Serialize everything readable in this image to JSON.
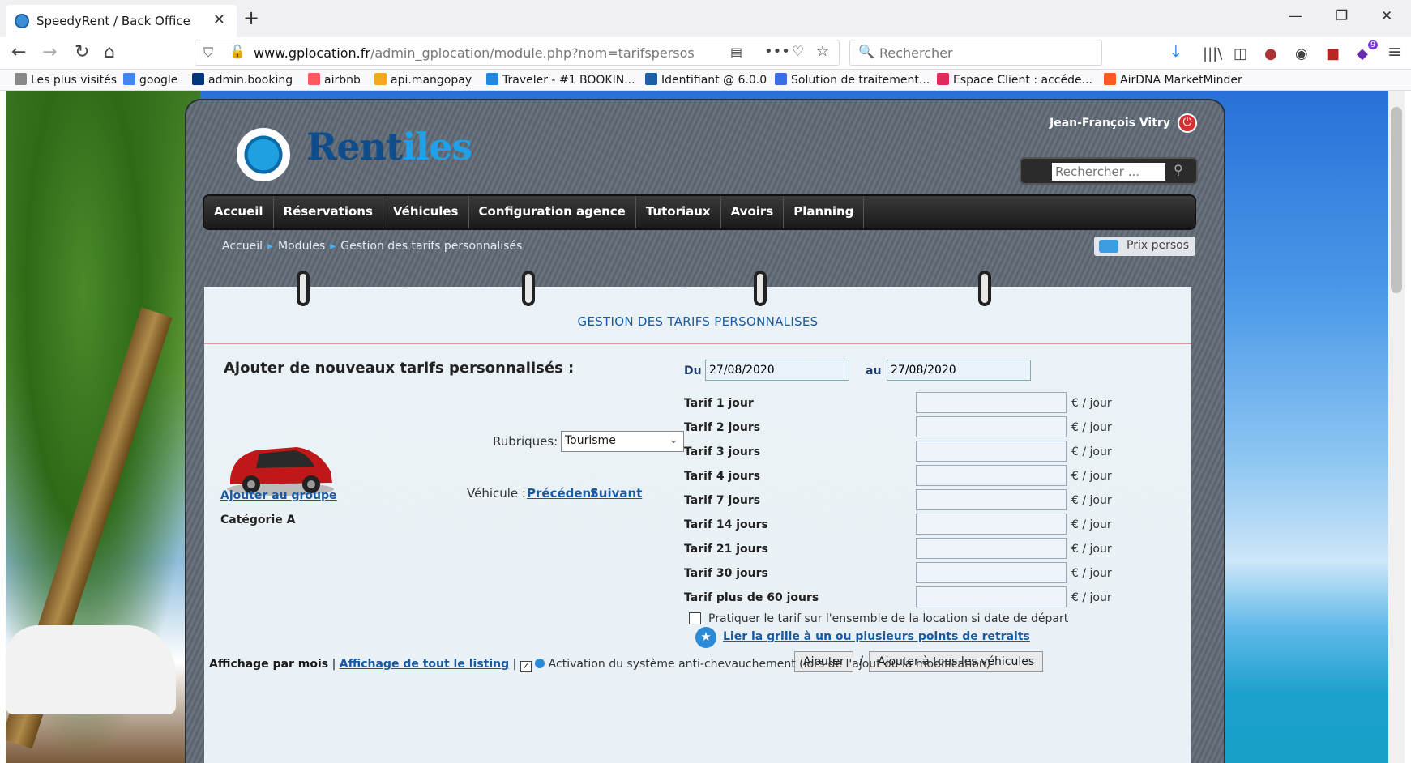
{
  "browser": {
    "tab_title": "SpeedyRent / Back Office",
    "url_domain": "www.gplocation.fr",
    "url_path": "/admin_gplocation/module.php?nom=tarifspersos",
    "search_placeholder": "Rechercher",
    "notif_count": "9"
  },
  "bookmarks": [
    "Les plus visités",
    "google",
    "admin.booking",
    "airbnb",
    "api.mangopay",
    "Traveler - #1 BOOKIN...",
    "Identifiant @ 6.0.0",
    "Solution de traitement...",
    "Espace Client : accéde...",
    "AirDNA MarketMinder"
  ],
  "site": {
    "logo_main": "Rent",
    "logo_accent": "iles",
    "user": "Jean-François Vitry",
    "search_placeholder": "Rechercher ...",
    "menu": [
      "Accueil",
      "Réservations",
      "Véhicules",
      "Configuration agence",
      "Tutoriaux",
      "Avoirs",
      "Planning"
    ],
    "breadcrumb": [
      "Accueil",
      "Modules",
      "Gestion des tarifs personnalisés"
    ],
    "prix_persos": "Prix persos"
  },
  "form": {
    "heading": "GESTION DES TARIFS PERSONNALISES",
    "title": "Ajouter de nouveaux tarifs personnalisés :",
    "du_label": "Du",
    "du_value": "27/08/2020",
    "au_label": "au",
    "au_value": "27/08/2020",
    "rubriques_label": "Rubriques:",
    "rubriques_value": "Tourisme",
    "vehicule_label": "Véhicule :",
    "prev": "Précédent",
    "next": "Suivant",
    "add_group": "Ajouter au groupe",
    "category": "Catégorie A",
    "rates": [
      "Tarif 1 jour",
      "Tarif 2 jours",
      "Tarif 3 jours",
      "Tarif 4 jours",
      "Tarif 7 jours",
      "Tarif 14 jours",
      "Tarif 21 jours",
      "Tarif 30 jours",
      "Tarif plus de 60 jours"
    ],
    "unit": "€ / jour",
    "check_label": "Pratiquer le tarif sur l'ensemble de la location si date de départ",
    "link_points": "Lier la grille à un ou plusieurs points de retraits",
    "btn_add": "Ajouter",
    "slash": "/",
    "btn_add_all": "Ajouter à tous les véhicules",
    "display_month": "Affichage par mois",
    "display_all": "Affichage de tout le listing",
    "activation": "Activation du système anti-chevauchement (lors de l'ajout ou la modification)"
  }
}
